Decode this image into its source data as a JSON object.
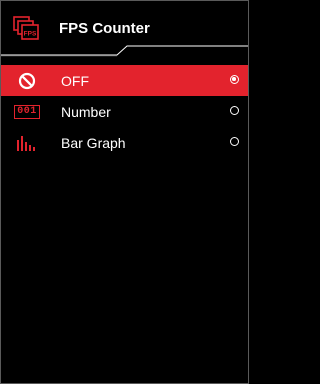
{
  "header": {
    "title": "FPS Counter",
    "icon_text": "FPS",
    "icon": "fps-window-icon"
  },
  "menu": {
    "items": [
      {
        "label": "OFF",
        "icon": "prohibited-icon",
        "selected": true
      },
      {
        "label": "Number",
        "icon": "number-icon",
        "icon_text": "001",
        "selected": false
      },
      {
        "label": "Bar Graph",
        "icon": "bar-graph-icon",
        "selected": false
      }
    ]
  },
  "colors": {
    "accent": "#e3232d",
    "background": "#000000",
    "text": "#ffffff"
  }
}
